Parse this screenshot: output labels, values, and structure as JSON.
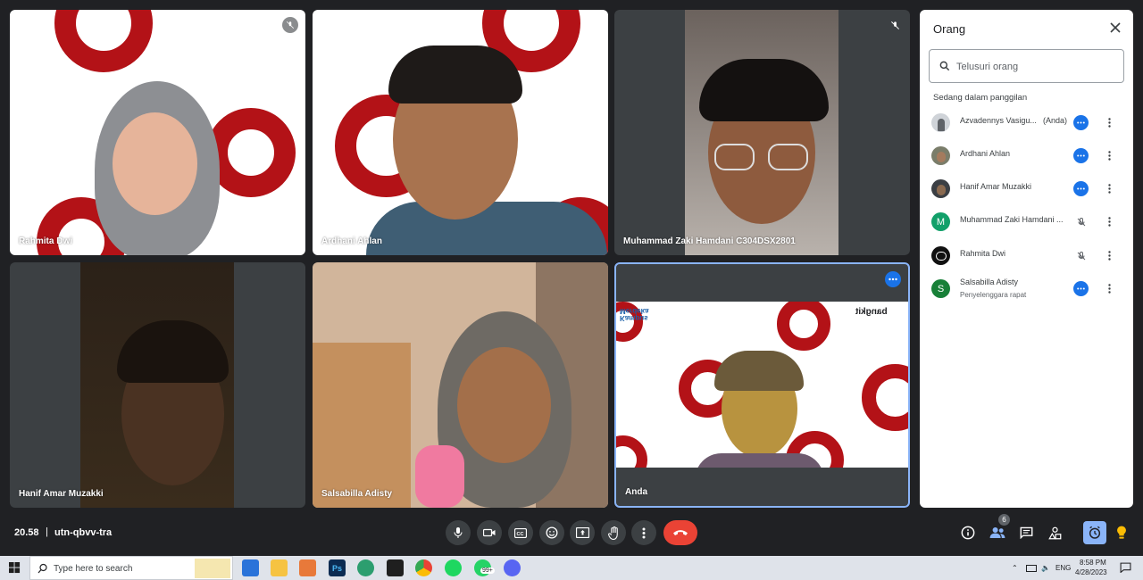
{
  "meeting": {
    "time": "20.58",
    "separator": "|",
    "code": "utn-qbvv-tra"
  },
  "tiles": [
    {
      "name": "Rahmita Dwi",
      "muted": true
    },
    {
      "name": "Ardhani Ahlan",
      "muted": false
    },
    {
      "name": "Muhammad Zaki Hamdani C304DSX2801",
      "muted": true
    },
    {
      "name": "Hanif Amar Muzakki",
      "muted": false
    },
    {
      "name": "Salsabilla Adisty",
      "muted": false
    },
    {
      "name": "Anda",
      "muted": false
    }
  ],
  "background_overlay": {
    "logo_left": "Kampus Merdeka",
    "logo_right": "bangkit"
  },
  "people_panel": {
    "title": "Orang",
    "search_placeholder": "Telusuri orang",
    "section_label": "Sedang dalam panggilan",
    "participants": [
      {
        "name": "Azvadennys Vasigu...",
        "tag": "(Anda)",
        "subtitle": "",
        "avatar": "photo",
        "state": "speaking"
      },
      {
        "name": "Ardhani Ahlan",
        "tag": "",
        "subtitle": "",
        "avatar": "photo",
        "state": "speaking"
      },
      {
        "name": "Hanif Amar Muzakki",
        "tag": "",
        "subtitle": "",
        "avatar": "photo",
        "state": "speaking"
      },
      {
        "name": "Muhammad Zaki Hamdani ...",
        "tag": "",
        "subtitle": "",
        "avatar": "M",
        "state": "muted"
      },
      {
        "name": "Rahmita Dwi",
        "tag": "",
        "subtitle": "",
        "avatar": "photo",
        "state": "muted"
      },
      {
        "name": "Salsabilla Adisty",
        "tag": "",
        "subtitle": "Penyelenggara rapat",
        "avatar": "S",
        "state": "speaking"
      }
    ]
  },
  "controls": {
    "center": [
      "mic-icon",
      "camera-icon",
      "captions-icon",
      "emoji-icon",
      "present-icon",
      "raise-hand-icon",
      "more-options-icon",
      "end-call-icon"
    ],
    "right": [
      "info-icon",
      "people-icon",
      "chat-icon",
      "activities-icon",
      "host-controls-icon",
      "lightbulb-icon"
    ],
    "people_count": "6"
  },
  "colors": {
    "accent": "#1a73e8",
    "end_call": "#ea4335",
    "dark_bg": "#202124",
    "brand_red": "#b31217"
  },
  "taskbar": {
    "search_placeholder": "Type here to search",
    "badge": "99+",
    "language": "ENG",
    "clock_time": "8:58 PM",
    "clock_date": "4/28/2023"
  }
}
